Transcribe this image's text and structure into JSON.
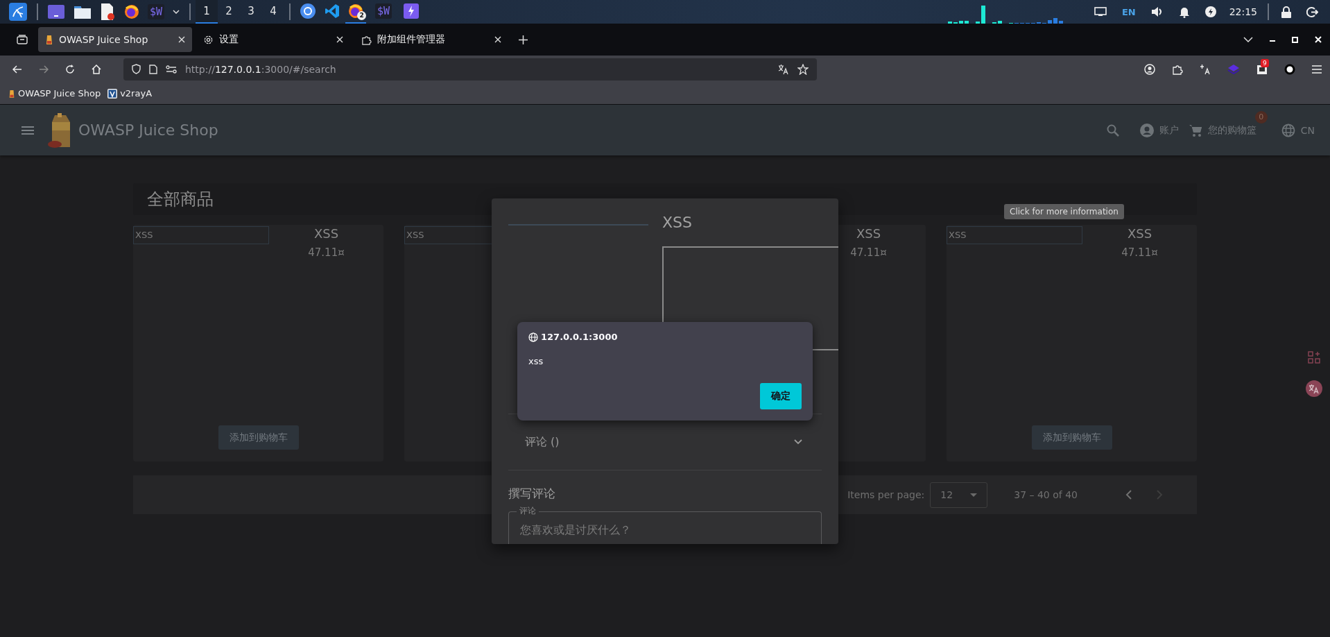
{
  "taskbar": {
    "launchers": [
      {
        "kind": "terminal"
      },
      {
        "kind": "files"
      },
      {
        "kind": "editor"
      },
      {
        "kind": "firefox"
      },
      {
        "kind": "text",
        "label": "$W"
      }
    ],
    "workspaces": [
      {
        "label": "1",
        "selected": true
      },
      {
        "label": "2",
        "selected": false
      },
      {
        "label": "3",
        "selected": false
      },
      {
        "label": "4",
        "selected": false
      }
    ],
    "apps": [
      {
        "kind": "chromium",
        "selected": false
      },
      {
        "kind": "vscode",
        "selected": false
      },
      {
        "kind": "firefox",
        "selected": true,
        "badge": "2"
      },
      {
        "kind": "text",
        "label": "$W",
        "selected": false
      },
      {
        "kind": "bolt",
        "selected": false
      }
    ],
    "tray": {
      "language": "EN",
      "clock": "22:15"
    }
  },
  "browser": {
    "tabs": [
      {
        "kind": "juice",
        "label": "OWASP Juice Shop",
        "selected": true
      },
      {
        "kind": "gear",
        "label": "设置",
        "selected": false
      },
      {
        "kind": "puzzle",
        "label": "附加组件管理器",
        "selected": false
      }
    ],
    "url": {
      "scheme": "http://",
      "host": "127.0.0.1",
      "path": ":3000/#/search"
    },
    "extension_badge": "9",
    "bookmarks": [
      {
        "kind": "juice",
        "label": "OWASP Juice Shop"
      },
      {
        "kind": "v",
        "label": "v2rayA"
      }
    ]
  },
  "app": {
    "title": "OWASP Juice Shop",
    "account": "账户",
    "basket": "您的购物篮",
    "basket_count": "0",
    "language": "CN"
  },
  "page": {
    "heading": "全部商品",
    "tooltip": "Click for more information",
    "products": [
      {
        "field": "XSS",
        "title": "XSS",
        "price": "47.11¤",
        "button": "添加到购物车"
      },
      {
        "field": "XSS"
      },
      {
        "title": "XSS",
        "price": "47.11¤"
      },
      {
        "field": "XSS",
        "title": "XSS",
        "price": "47.11¤",
        "button": "添加到购物车"
      }
    ],
    "paginator": {
      "label": "Items per page:",
      "page_size": "12",
      "range": "37 – 40 of 40",
      "prev_disabled": false,
      "next_disabled": true
    }
  },
  "dialog": {
    "title": "XSS",
    "reviews": "评论 ()",
    "write_heading": "撰写评论",
    "field_label": "评论",
    "placeholder": "您喜欢或是讨厌什么？"
  },
  "alert": {
    "origin": "127.0.0.1:3000",
    "message": "xss",
    "button": "确定"
  }
}
